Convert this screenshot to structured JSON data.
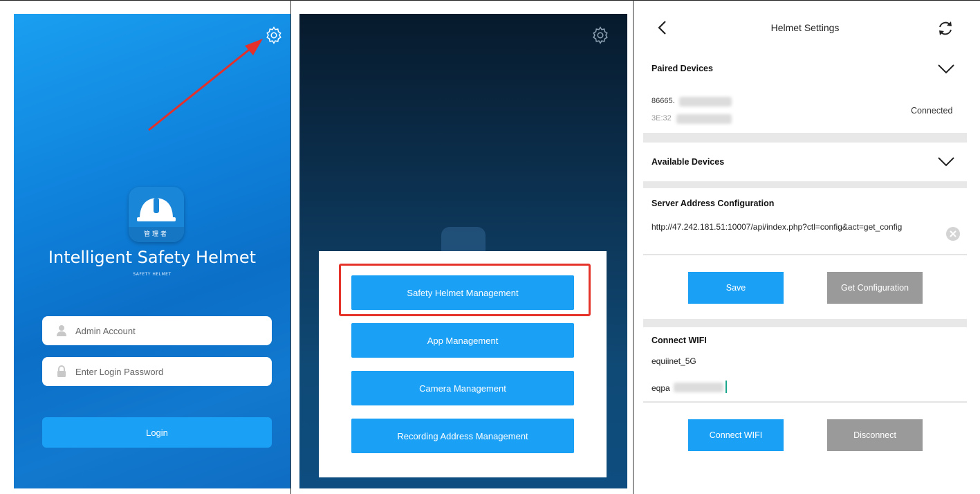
{
  "login_screen": {
    "app_badge": "管理者",
    "title": "Intelligent Safety Helmet",
    "subtitle": "SAFETY HELMET",
    "account_placeholder": "Admin Account",
    "password_placeholder": "Enter Login Password",
    "login_label": "Login",
    "icons": [
      "gear-icon",
      "user-icon",
      "lock-icon",
      "helmet-icon"
    ]
  },
  "management_menu": {
    "buttons": [
      "Safety Helmet Management",
      "App Management",
      "Camera Management",
      "Recording Address Management"
    ],
    "highlight_color": "#e5332a"
  },
  "helmet_settings": {
    "title": "Helmet Settings",
    "paired_devices_label": "Paired Devices",
    "paired_device": {
      "name": "86665.",
      "mac": "3E:32",
      "status": "Connected"
    },
    "available_devices_label": "Available Devices",
    "server_config_label": "Server Address Configuration",
    "server_url": "http://47.242.181.51:10007/api/index.php?ctl=config&act=get_config",
    "save_label": "Save",
    "get_config_label": "Get Configuration",
    "wifi_label": "Connect WIFI",
    "wifi_ssid": "equiinet_5G",
    "wifi_password": "eqpa",
    "connect_label": "Connect WIFI",
    "disconnect_label": "Disconnect"
  },
  "colors": {
    "accent": "#1aa0f5",
    "disabled": "#9a9a9a"
  }
}
